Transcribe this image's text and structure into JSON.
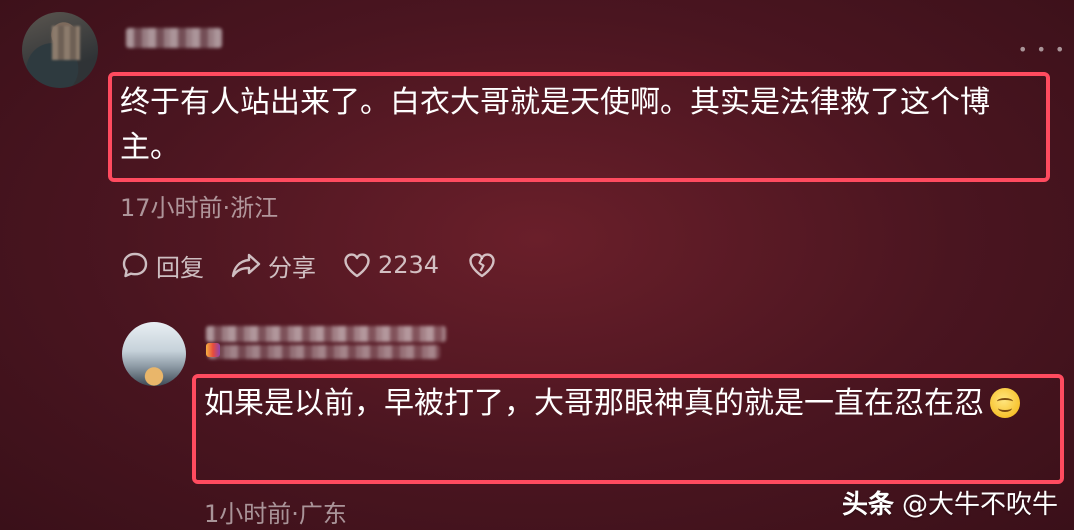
{
  "comments": [
    {
      "text": "终于有人站出来了。白衣大哥就是天使啊。其实是法律救了这个博主。",
      "meta": "17小时前·浙江",
      "actions": {
        "reply_label": "回复",
        "share_label": "分享",
        "like_count": "2234"
      }
    }
  ],
  "reply": {
    "text": "如果是以前，早被打了，大哥那眼神真的就是一直在忍在忍",
    "emoji": "smile-emoji",
    "meta": "1小时前·广东"
  },
  "watermark": {
    "brand": "头条",
    "handle": "@大牛不吹牛"
  },
  "colors": {
    "background": "#4a1520",
    "highlight_border": "#ff4b5f"
  }
}
